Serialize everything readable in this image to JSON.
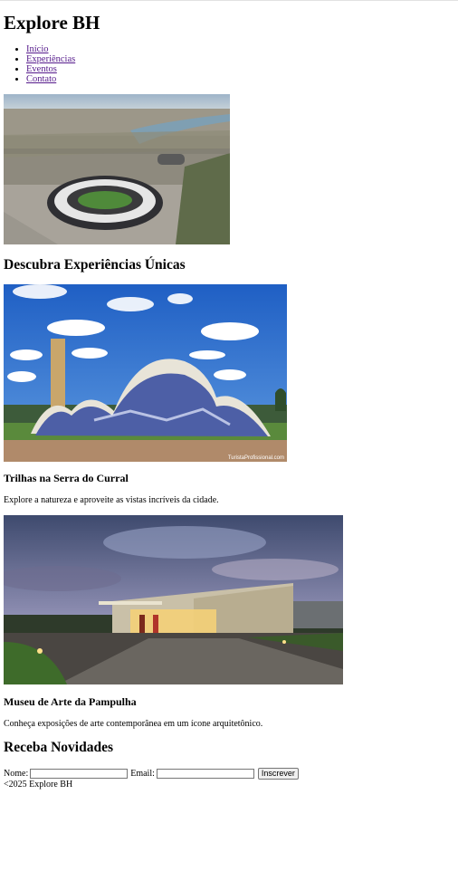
{
  "header": {
    "title": "Explore BH"
  },
  "nav": {
    "items": [
      {
        "label": "Início"
      },
      {
        "label": "Experiências"
      },
      {
        "label": "Eventos"
      },
      {
        "label": "Contato"
      }
    ]
  },
  "hero": {
    "image": "stadium-aerial-photo"
  },
  "experiences": {
    "heading": "Descubra Experiências Únicas",
    "items": [
      {
        "image": "pampulha-church-photo",
        "image_caption": "TuristaProfissional.com",
        "title": "Trilhas na Serra do Curral",
        "description": "Explore a natureza e aproveite as vistas incríveis da cidade."
      },
      {
        "image": "art-museum-photo",
        "title": "Museu de Arte da Pampulha",
        "description": "Conheça exposições de arte contemporânea em um ícone arquitetônico."
      }
    ]
  },
  "newsletter": {
    "heading": "Receba Novidades",
    "name_label": "Nome:",
    "name_value": "",
    "email_label": "Email:",
    "email_value": "",
    "submit_label": "Inscrever"
  },
  "footer": {
    "text": "<2025 Explore BH"
  }
}
